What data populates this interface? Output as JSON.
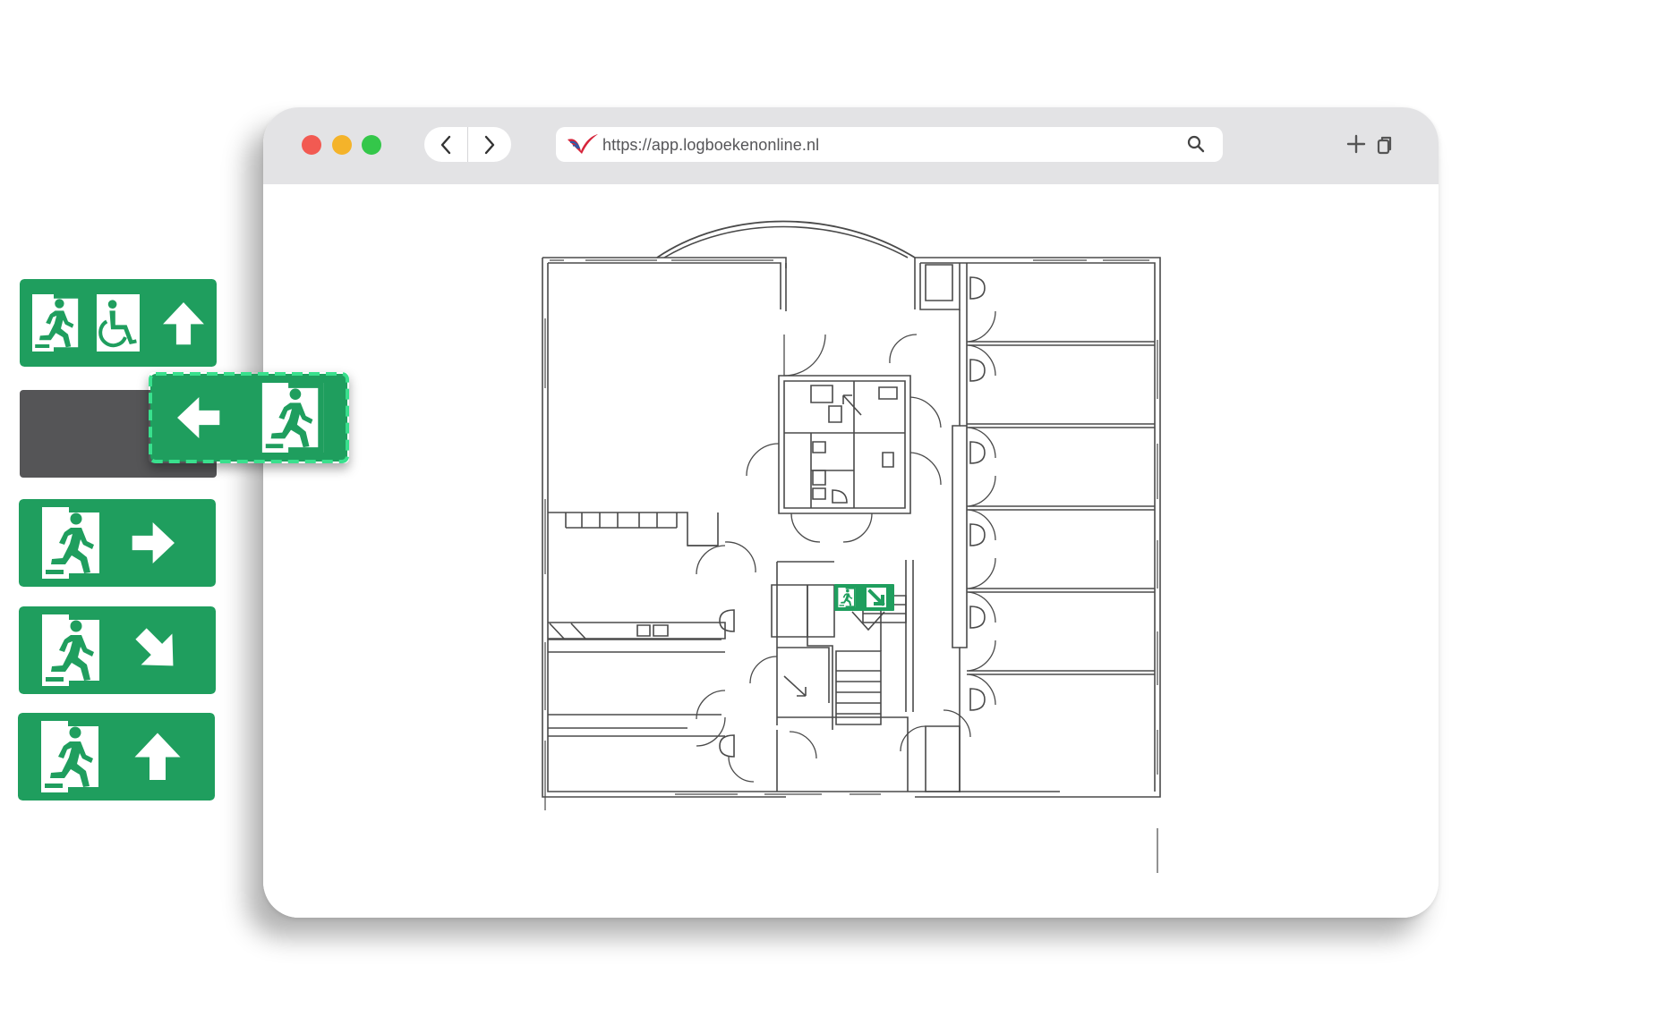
{
  "browser": {
    "url": "https://app.logboekenonline.nl",
    "traffic_lights": {
      "close": "#f25a52",
      "minimize": "#f4b32a",
      "maximize": "#34c74a"
    },
    "titlebar_color": "#e3e3e5",
    "icons": {
      "back": "chevron-left-icon",
      "forward": "chevron-right-icon",
      "search": "search-icon",
      "new_tab": "plus-icon",
      "tabs": "tabs-icon",
      "logo": "logboeken-logo"
    }
  },
  "floor_plan": {
    "placed_sign": {
      "symbols": [
        "running-person",
        "arrow-down-right"
      ]
    }
  },
  "sign_palette": {
    "sign_color": "#1f9e5e",
    "selection_outline_color": "#39e08d",
    "signs": [
      {
        "symbols": [
          "running-person-exit",
          "wheelchair",
          "arrow-up"
        ],
        "selected": false
      },
      {
        "symbols": [
          "arrow-left",
          "running-person-exit"
        ],
        "selected": true
      },
      {
        "symbols": [
          "running-person-exit",
          "arrow-right"
        ],
        "selected": false
      },
      {
        "symbols": [
          "running-person-exit",
          "arrow-down-right"
        ],
        "selected": false
      },
      {
        "symbols": [
          "running-person-exit",
          "arrow-up"
        ],
        "selected": false
      }
    ]
  }
}
